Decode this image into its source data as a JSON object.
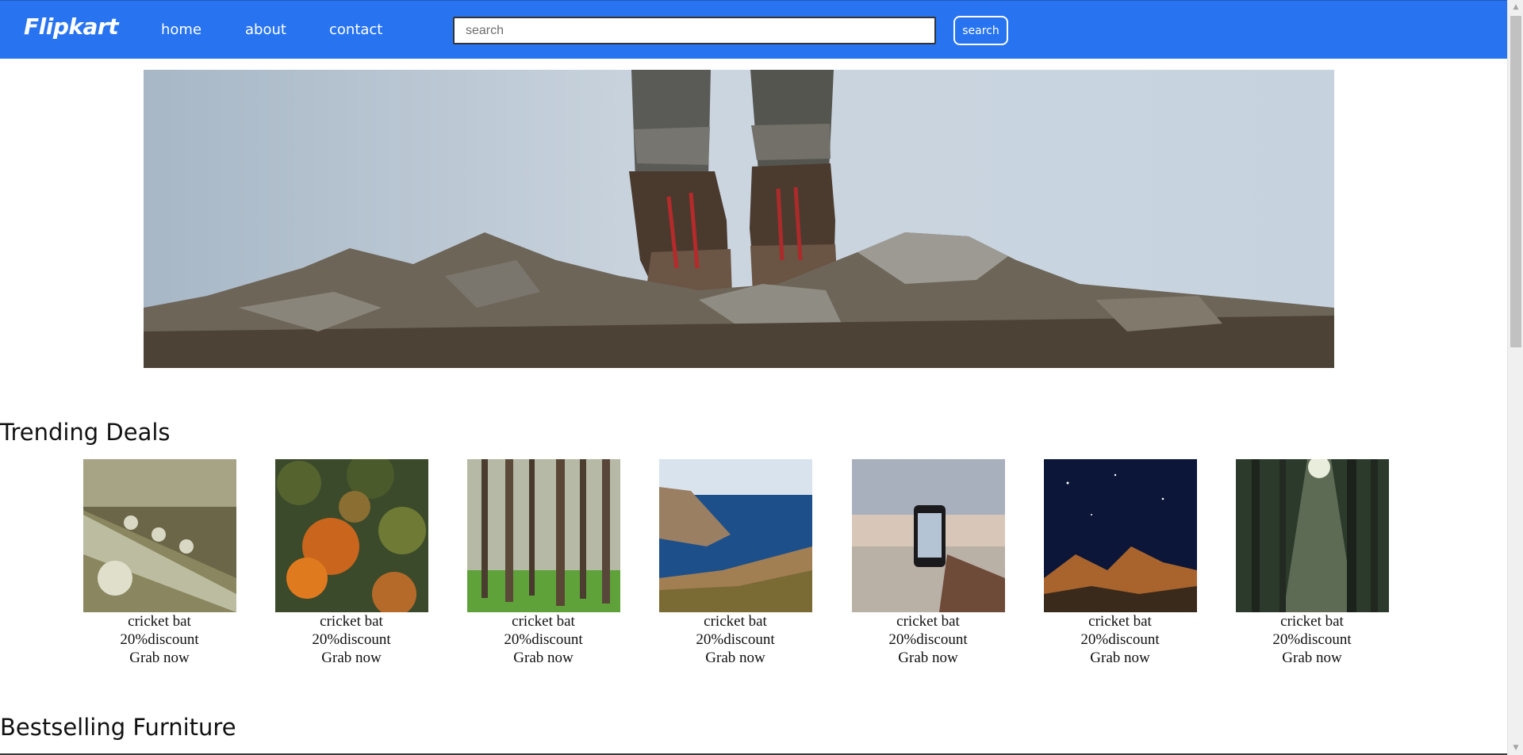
{
  "navbar": {
    "logo": "Flipkart",
    "links": [
      "home",
      "about",
      "contact"
    ],
    "search_placeholder": "search",
    "search_button": "search",
    "background": "#2874f0"
  },
  "hero": {
    "image": "hiking boots on rocky ground"
  },
  "sections": {
    "trending_title": "Trending Deals",
    "furniture_title": "Bestselling Furniture"
  },
  "deals": [
    {
      "image": "guitar headstock",
      "name": "cricket bat",
      "discount": "20%discount",
      "cta": "Grab now"
    },
    {
      "image": "autumn forest aerial",
      "name": "cricket bat",
      "discount": "20%discount",
      "cta": "Grab now"
    },
    {
      "image": "pine forest",
      "name": "cricket bat",
      "discount": "20%discount",
      "cta": "Grab now"
    },
    {
      "image": "coastal cliffs",
      "name": "cricket bat",
      "discount": "20%discount",
      "cta": "Grab now"
    },
    {
      "image": "phone photo at sunset",
      "name": "cricket bat",
      "discount": "20%discount",
      "cta": "Grab now"
    },
    {
      "image": "mountains at night",
      "name": "cricket bat",
      "discount": "20%discount",
      "cta": "Grab now"
    },
    {
      "image": "misty forest",
      "name": "cricket bat",
      "discount": "20%discount",
      "cta": "Grab now"
    }
  ]
}
